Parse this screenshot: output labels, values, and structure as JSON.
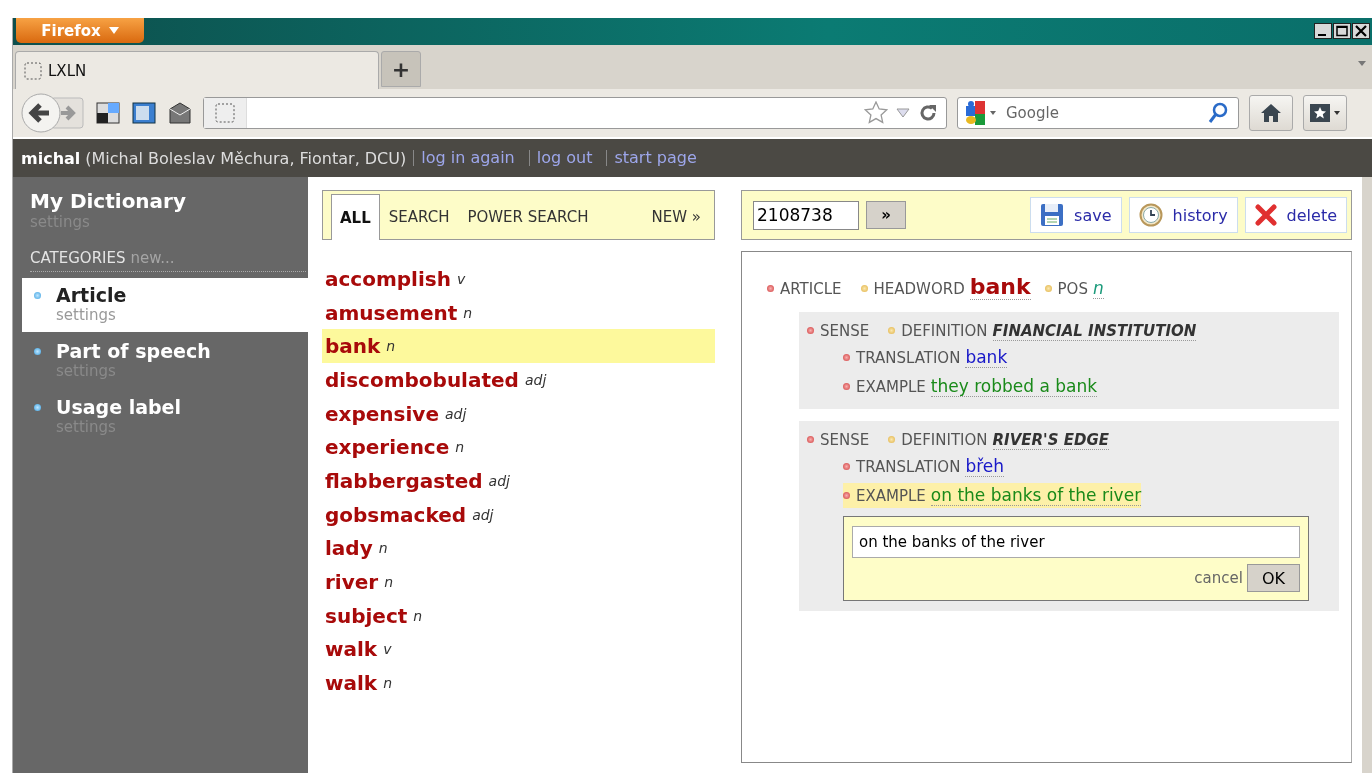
{
  "browser": {
    "menu_button": "Firefox",
    "tabs": [
      {
        "label": "LXLN",
        "selected": true
      }
    ],
    "new_tab_button": "+",
    "search": {
      "placeholder": "Google"
    }
  },
  "user_bar": {
    "username": "michal",
    "details": "(Michal Boleslav Měchura, Fiontar, DCU)",
    "links": [
      "log in again",
      "log out",
      "start page"
    ]
  },
  "sidebar": {
    "title": "My Dictionary",
    "title_link": "settings",
    "categories_label": "CATEGORIES",
    "new_link": "new...",
    "items": [
      {
        "label": "Article",
        "link": "settings",
        "selected": true
      },
      {
        "label": "Part of speech",
        "link": "settings",
        "selected": false
      },
      {
        "label": "Usage label",
        "link": "settings",
        "selected": false
      }
    ]
  },
  "entry_list": {
    "tabs": [
      {
        "label": "ALL",
        "selected": true
      },
      {
        "label": "SEARCH",
        "selected": false
      },
      {
        "label": "POWER SEARCH",
        "selected": false
      },
      {
        "label": "NEW »",
        "selected": false
      }
    ],
    "entries": [
      {
        "headword": "accomplish",
        "pos": "v",
        "selected": false
      },
      {
        "headword": "amusement",
        "pos": "n",
        "selected": false
      },
      {
        "headword": "bank",
        "pos": "n",
        "selected": true
      },
      {
        "headword": "discombobulated",
        "pos": "adj",
        "selected": false
      },
      {
        "headword": "expensive",
        "pos": "adj",
        "selected": false
      },
      {
        "headword": "experience",
        "pos": "n",
        "selected": false
      },
      {
        "headword": "flabbergasted",
        "pos": "adj",
        "selected": false
      },
      {
        "headword": "gobsmacked",
        "pos": "adj",
        "selected": false
      },
      {
        "headword": "lady",
        "pos": "n",
        "selected": false
      },
      {
        "headword": "river",
        "pos": "n",
        "selected": false
      },
      {
        "headword": "subject",
        "pos": "n",
        "selected": false
      },
      {
        "headword": "walk",
        "pos": "v",
        "selected": false
      },
      {
        "headword": "walk",
        "pos": "n",
        "selected": false
      }
    ]
  },
  "editor": {
    "id_field": {
      "value": "2108738"
    },
    "go_button": "»",
    "actions": [
      {
        "label": "save",
        "kind": "save"
      },
      {
        "label": "history",
        "kind": "history"
      },
      {
        "label": "delete",
        "kind": "delete"
      }
    ],
    "article": {
      "label": "ARTICLE",
      "headword_label": "HEADWORD",
      "headword": "bank",
      "pos_label": "POS",
      "pos": "n",
      "senses": [
        {
          "label": "SENSE",
          "definition_label": "DEFINITION",
          "definition": "FINANCIAL INSTITUTION",
          "children": [
            {
              "kind": "translation",
              "label": "TRANSLATION",
              "value": "bank",
              "selected": false
            },
            {
              "kind": "example",
              "label": "EXAMPLE",
              "value": "they robbed a bank",
              "selected": false
            }
          ]
        },
        {
          "label": "SENSE",
          "definition_label": "DEFINITION",
          "definition": "RIVER'S EDGE",
          "children": [
            {
              "kind": "translation",
              "label": "TRANSLATION",
              "value": "břeh",
              "selected": false
            },
            {
              "kind": "example",
              "label": "EXAMPLE",
              "value": "on the banks of the river",
              "selected": true,
              "edit_box": {
                "value": "on the banks of the river",
                "cancel": "cancel",
                "ok": "OK"
              }
            }
          ]
        }
      ]
    }
  }
}
